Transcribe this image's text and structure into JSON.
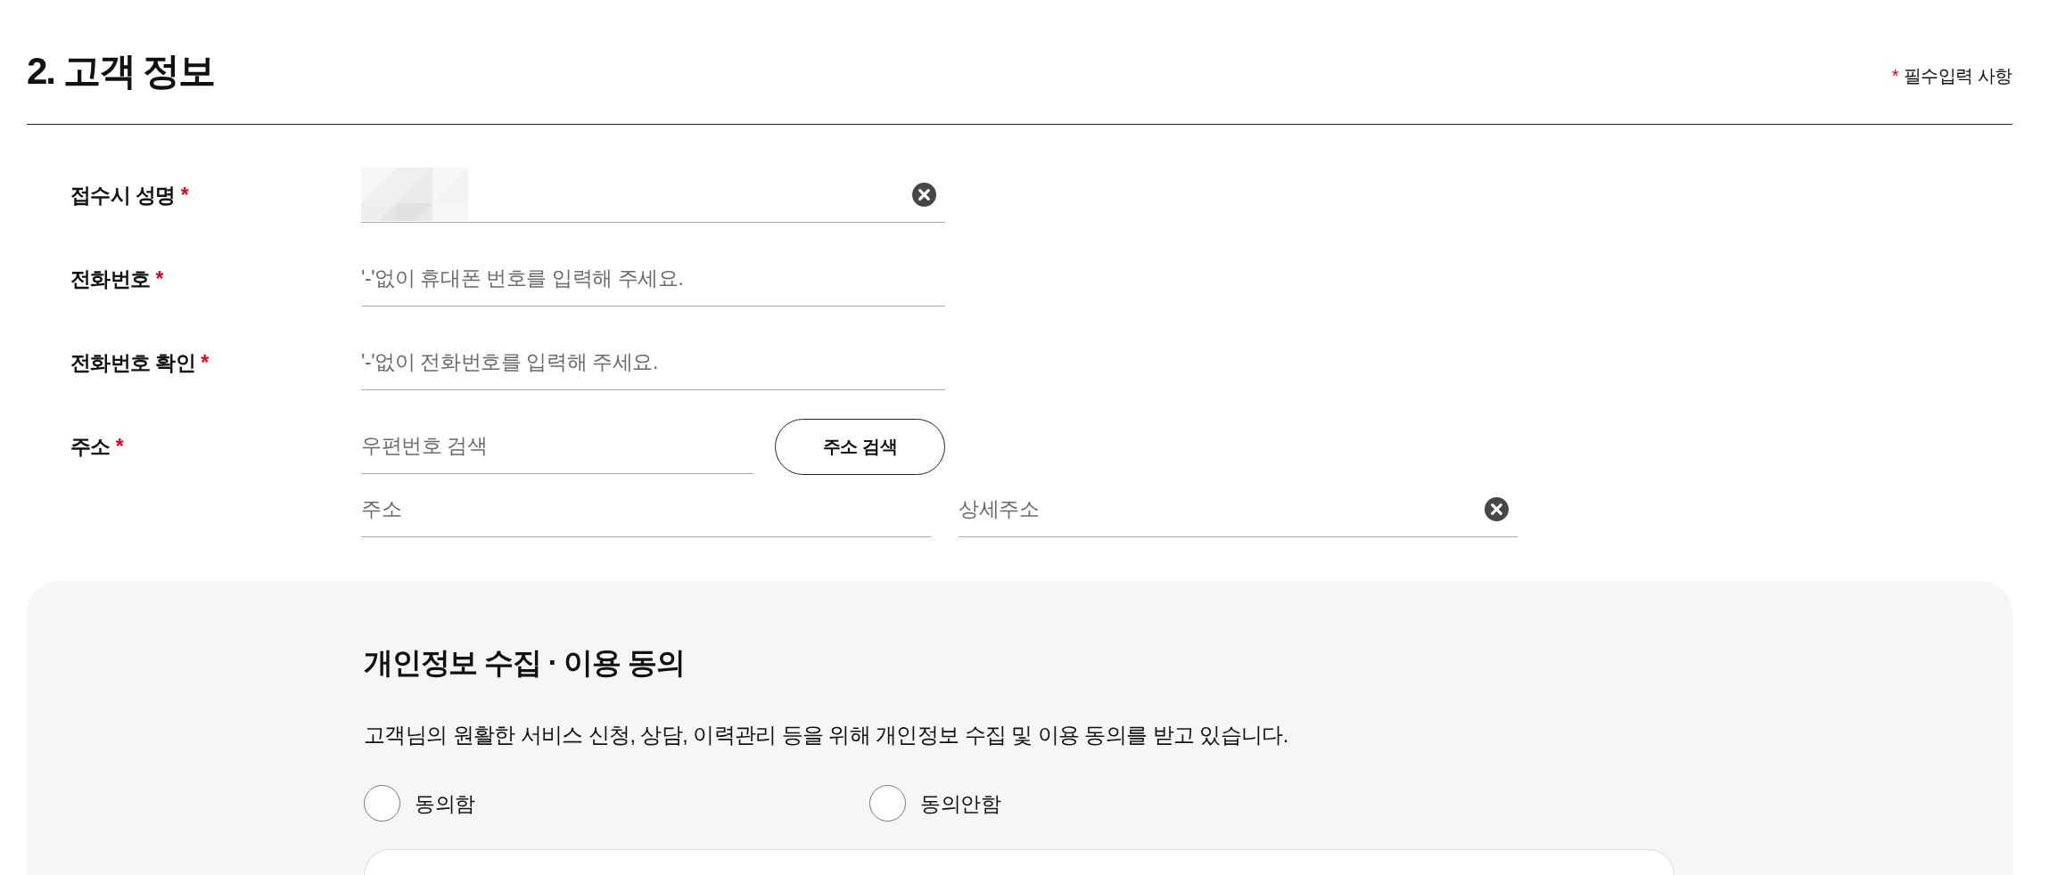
{
  "section": {
    "title": "2. 고객 정보",
    "required_note": {
      "mark": "*",
      "text": "필수입력 사항"
    }
  },
  "fields": [
    {
      "kind": "text",
      "label": "접수시 성명",
      "required_mark": "*",
      "value_hidden": true,
      "clear_button": true
    },
    {
      "kind": "text",
      "label": "전화번호",
      "required_mark": "*",
      "placeholder": "'-'없이 휴대폰 번호를 입력해 주세요."
    },
    {
      "kind": "text",
      "label": "전화번호 확인",
      "required_mark": "*",
      "placeholder": "'-'없이 전화번호를 입력해 주세요."
    },
    {
      "kind": "address",
      "label": "주소",
      "required_mark": "*",
      "postcode": {
        "placeholder": "우편번호 검색"
      },
      "search_button": "주소 검색",
      "address": {
        "placeholder": "주소"
      },
      "detail_address": {
        "placeholder": "상세주소",
        "clear_button": true
      }
    }
  ],
  "consent": {
    "title": "개인정보 수집 · 이용 동의",
    "description": "고객님의 원활한 서비스 신청, 상담, 이력관리 등을 위해 개인정보 수집 및 이용 동의를 받고 있습니다.",
    "options": [
      {
        "label": "동의함",
        "selected": false
      },
      {
        "label": "동의안함",
        "selected": false
      }
    ]
  }
}
